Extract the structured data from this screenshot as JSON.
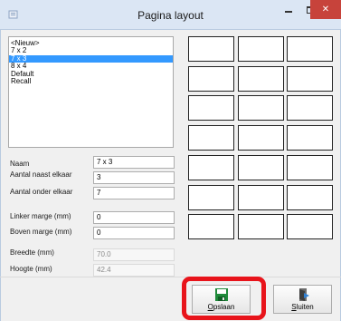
{
  "window": {
    "title": "Pagina layout"
  },
  "titlebar": {
    "close_glyph": "✕"
  },
  "layouts": {
    "items": [
      "<Nieuw>",
      "7 x 2",
      "7 x 3",
      "8 x 4",
      "Default",
      "Recall"
    ],
    "selected_index": 2
  },
  "form": {
    "naam": {
      "label": "Naam",
      "value": "7 x 3"
    },
    "aantal_naast": {
      "label": "Aantal naast elkaar",
      "value": "3"
    },
    "aantal_onder": {
      "label": "Aantal onder elkaar",
      "value": "7"
    },
    "linker_marge": {
      "label": "Linker marge (mm)",
      "value": "0"
    },
    "boven_marge": {
      "label": "Boven marge (mm)",
      "value": "0"
    },
    "breedte": {
      "label": "Breedte (mm)",
      "value": "70.0"
    },
    "hoogte": {
      "label": "Hoogte (mm)",
      "value": "42.4"
    }
  },
  "preview": {
    "columns": 3,
    "rows": 7
  },
  "buttons": {
    "opslaan": {
      "mnemonic": "O",
      "rest": "pslaan",
      "icon": "save-disk-icon"
    },
    "sluiten": {
      "mnemonic": "S",
      "rest": "luiten",
      "icon": "exit-door-icon"
    }
  },
  "colors": {
    "selection": "#3399ff",
    "close": "#c7433b",
    "highlight": "#e8141b",
    "save_icon": "#1f8a3a"
  }
}
